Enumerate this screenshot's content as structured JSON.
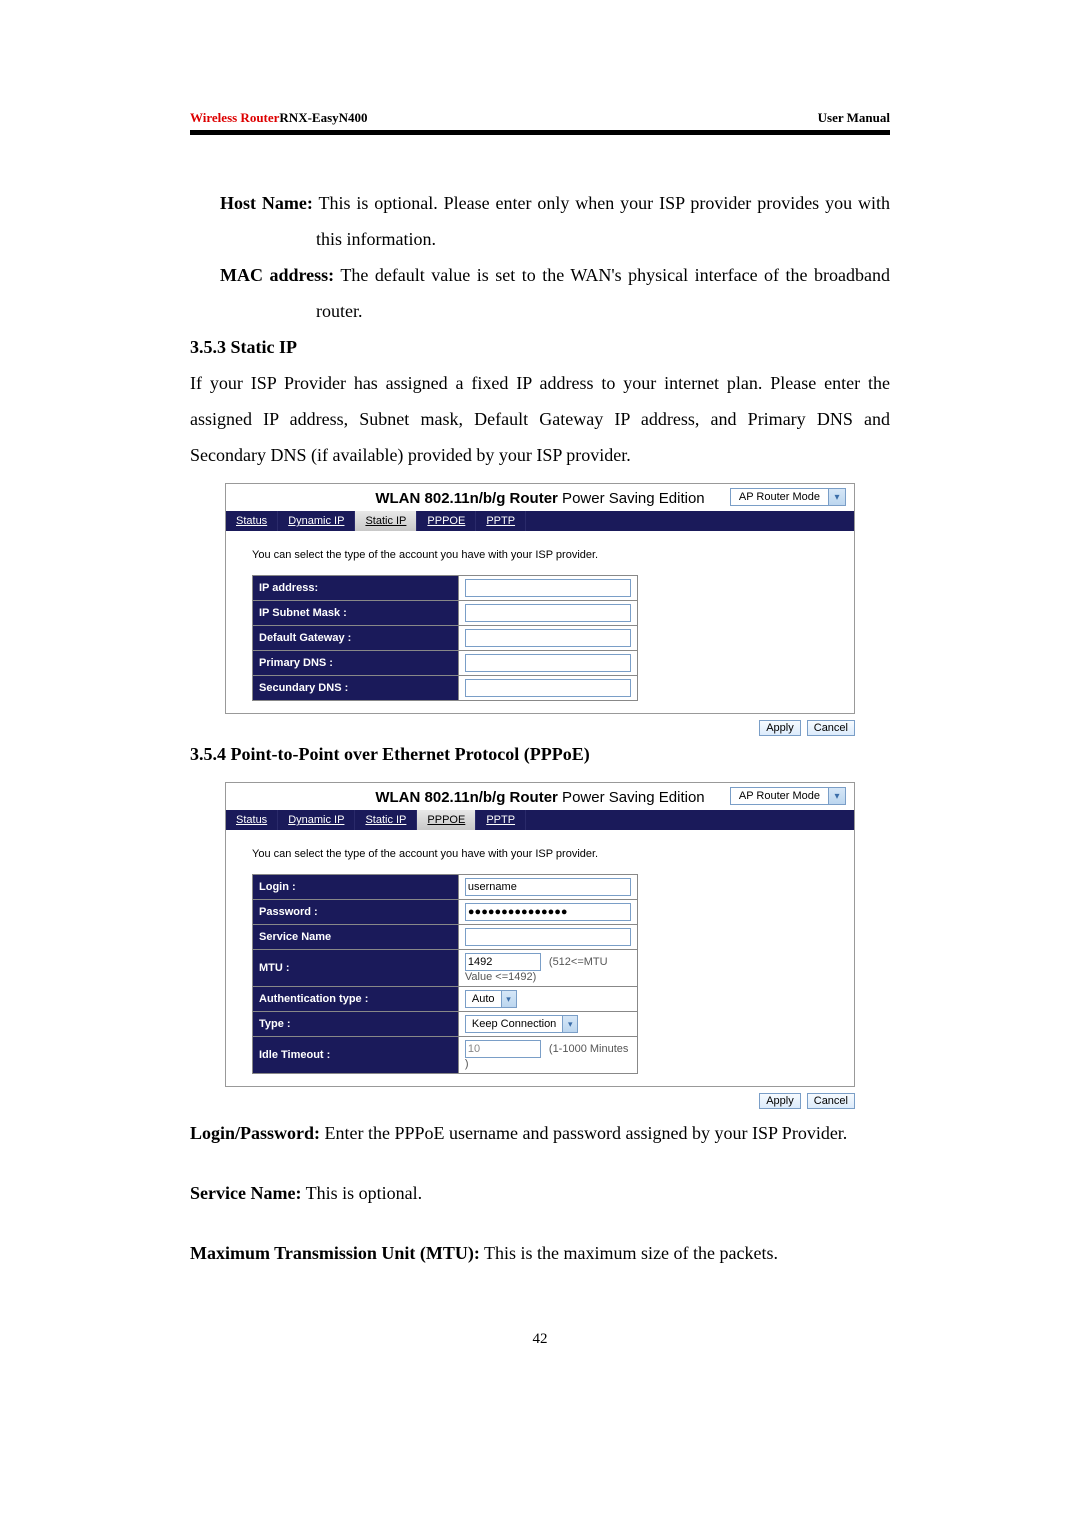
{
  "header": {
    "brand": "Wireless Router",
    "model": "RNX-EasyN400",
    "right": "User Manual"
  },
  "body": {
    "host_name_label": "Host Name:",
    "host_name_text": " This is optional. Please enter only when your ISP provider provides you with this information.",
    "mac_label": "MAC address:",
    "mac_text": " The default value is set to the WAN's physical interface of the broadband router.",
    "static_ip_heading": "3.5.3 Static IP",
    "static_ip_intro": "If your ISP Provider has assigned a fixed IP address to your internet plan. Please enter the assigned IP address, Subnet mask, Default Gateway IP address, and Primary DNS and Secondary DNS (if available) provided by your ISP provider.",
    "pppoe_heading": "3.5.4 Point-to-Point over Ethernet Protocol (PPPoE)",
    "login_pw_label": "Login/Password:",
    "login_pw_text": " Enter the PPPoE username and password assigned by your ISP Provider.",
    "service_name_label": "Service Name:",
    "service_name_text": " This is optional.",
    "mtu_label": "Maximum Transmission Unit (MTU):",
    "mtu_text": " This is the maximum size of the packets."
  },
  "panel_common": {
    "title_bold": "WLAN 802.11n/b/g Router",
    "title_rest": " Power Saving Edition",
    "mode_label": "AP Router Mode",
    "tabs": [
      "Status",
      "Dynamic IP",
      "Static IP",
      "PPPOE",
      "PPTP"
    ],
    "intro": "You can select the type of the account you have with your ISP provider.",
    "apply": "Apply",
    "cancel": "Cancel"
  },
  "static_panel": {
    "active_tab_index": 2,
    "fields": [
      {
        "label": "IP address:",
        "value": ""
      },
      {
        "label": "IP Subnet Mask :",
        "value": ""
      },
      {
        "label": "Default Gateway :",
        "value": ""
      },
      {
        "label": "Primary DNS :",
        "value": ""
      },
      {
        "label": "Secundary DNS :",
        "value": ""
      }
    ]
  },
  "pppoe_panel": {
    "active_tab_index": 3,
    "fields": {
      "login_label": "Login :",
      "login_value": "username",
      "password_label": "Password :",
      "password_value": "●●●●●●●●●●●●●●●",
      "service_label": "Service Name",
      "service_value": "",
      "mtu_label": "MTU :",
      "mtu_value": "1492",
      "mtu_note": "(512<=MTU Value <=1492)",
      "auth_label": "Authentication type :",
      "auth_value": "Auto",
      "type_label": "Type :",
      "type_value": "Keep Connection",
      "idle_label": "Idle Timeout :",
      "idle_value": "10",
      "idle_note": "(1-1000 Minutes )"
    }
  },
  "page_number": "42"
}
